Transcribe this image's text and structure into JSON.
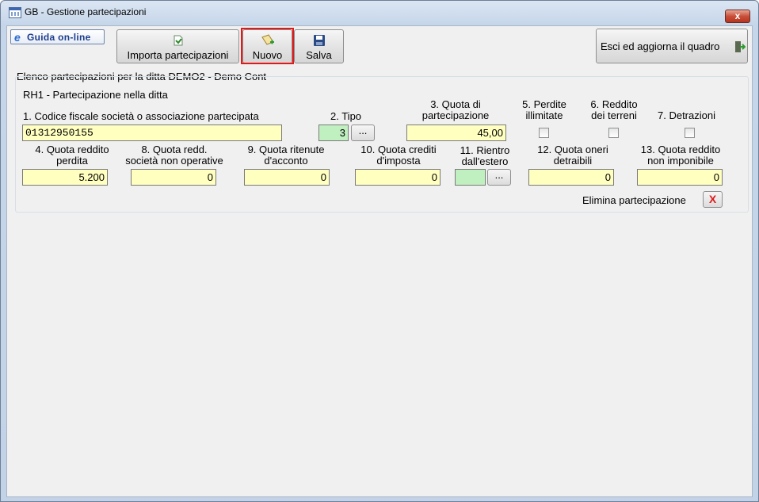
{
  "window": {
    "title": "GB - Gestione partecipazioni",
    "close_label": "x"
  },
  "toolbar": {
    "help_label": "Guida on-line",
    "help_icon": "e",
    "import_label": "Importa partecipazioni",
    "new_label": "Nuovo",
    "save_label": "Salva",
    "exit_label": "Esci ed aggiorna il quadro"
  },
  "header": {
    "list_label": "Elenco partecipazioni per la ditta DEMO2 -  Demo Cont"
  },
  "section": {
    "title": "RH1 - Partecipazione nella ditta"
  },
  "fields": {
    "f1": {
      "label": "1. Codice fiscale società o associazione partecipata",
      "value": "01312950155"
    },
    "f2": {
      "label": "2. Tipo",
      "value": "3",
      "button": "..."
    },
    "f3": {
      "label1": "3. Quota di",
      "label2": "partecipazione",
      "value": "45,00"
    },
    "f5": {
      "label1": "5. Perdite",
      "label2": "illimitate"
    },
    "f6": {
      "label1": "6. Reddito",
      "label2": "dei terreni"
    },
    "f7": {
      "label": "7. Detrazioni"
    },
    "f4": {
      "label1": "4. Quota reddito",
      "label2": "perdita",
      "value": "5.200"
    },
    "f8": {
      "label1": "8. Quota redd.",
      "label2": "società non operative",
      "value": "0"
    },
    "f9": {
      "label1": "9. Quota ritenute",
      "label2": "d'acconto",
      "value": "0"
    },
    "f10": {
      "label1": "10. Quota crediti",
      "label2": "d'imposta",
      "value": "0"
    },
    "f11": {
      "label1": "11. Rientro",
      "label2": "dall'estero",
      "value": "",
      "button": "..."
    },
    "f12": {
      "label1": "12. Quota oneri",
      "label2": "detraibili",
      "value": "0"
    },
    "f13": {
      "label1": "13. Quota reddito",
      "label2": "non imponibile",
      "value": "0"
    }
  },
  "delete": {
    "label": "Elimina partecipazione",
    "button": "X"
  },
  "colors": {
    "field_yellow": "#ffffc0",
    "field_green": "#c0f0c0",
    "highlight": "#e01a1a"
  }
}
